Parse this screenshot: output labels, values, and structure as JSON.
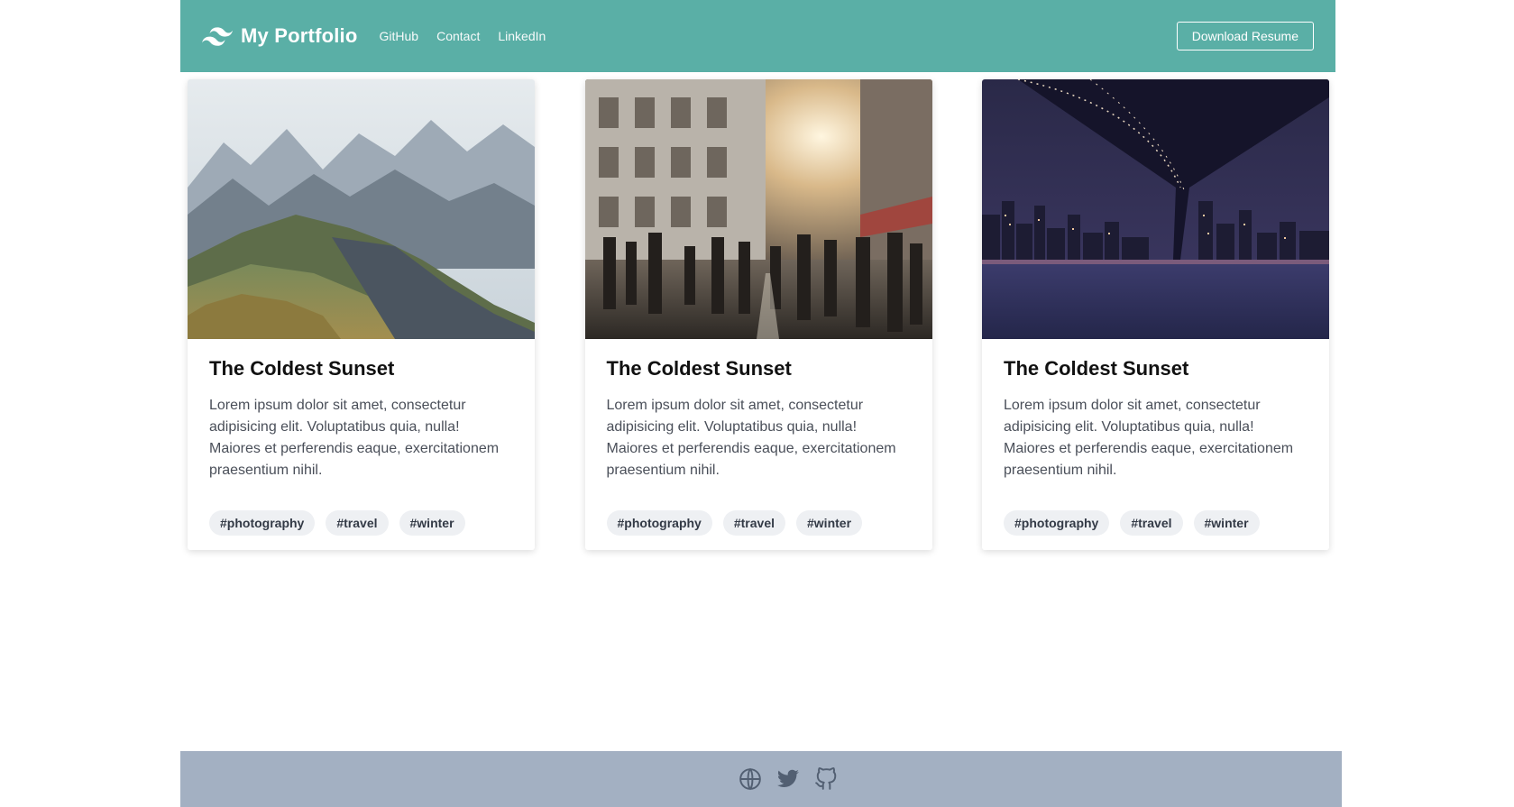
{
  "navbar": {
    "brand": "My Portfolio",
    "brand_icon": "wave-logo-icon",
    "links": [
      "GitHub",
      "Contact",
      "LinkedIn"
    ],
    "cta_label": "Download Resume",
    "bg_color": "#5aafa6"
  },
  "cards": [
    {
      "image": "mountain-landscape-photo",
      "title": "The Coldest Sunset",
      "text": "Lorem ipsum dolor sit amet, consectetur adipisicing elit. Voluptatibus quia, nulla! Maiores et perferendis eaque, exercitationem praesentium nihil.",
      "tags": [
        "#photography",
        "#travel",
        "#winter"
      ]
    },
    {
      "image": "city-street-sunset-photo",
      "title": "The Coldest Sunset",
      "text": "Lorem ipsum dolor sit amet, consectetur adipisicing elit. Voluptatibus quia, nulla! Maiores et perferendis eaque, exercitationem praesentium nihil.",
      "tags": [
        "#photography",
        "#travel",
        "#winter"
      ]
    },
    {
      "image": "bridge-night-skyline-photo",
      "title": "The Coldest Sunset",
      "text": "Lorem ipsum dolor sit amet, consectetur adipisicing elit. Voluptatibus quia, nulla! Maiores et perferendis eaque, exercitationem praesentium nihil.",
      "tags": [
        "#photography",
        "#travel",
        "#winter"
      ]
    }
  ],
  "footer": {
    "icons": [
      "globe-icon",
      "twitter-icon",
      "github-icon"
    ],
    "bg_color": "#a3b0c2"
  }
}
